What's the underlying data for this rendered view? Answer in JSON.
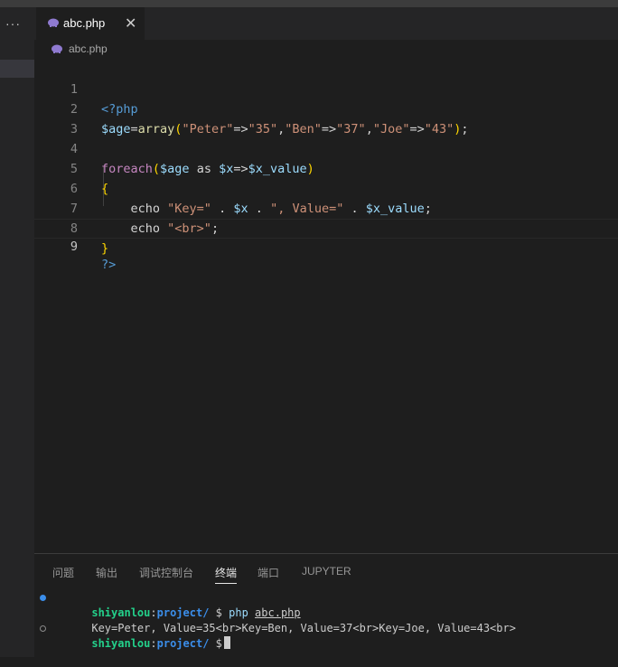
{
  "sidebar": {
    "more_label": "···"
  },
  "tab": {
    "title": "abc.php",
    "close_glyph": "✕",
    "icon": "php-elephant-icon"
  },
  "breadcrumb": {
    "file": "abc.php",
    "icon": "php-elephant-icon"
  },
  "code_lines": [
    {
      "n": "1",
      "text": "<?php"
    },
    {
      "n": "2",
      "text": "$age=array(\"Peter\"=>\"35\",\"Ben\"=>\"37\",\"Joe\"=>\"43\");"
    },
    {
      "n": "3",
      "text": ""
    },
    {
      "n": "4",
      "text": "foreach($age as $x=>$x_value)"
    },
    {
      "n": "5",
      "text": "{"
    },
    {
      "n": "6",
      "text": "    echo \"Key=\" . $x . \", Value=\" . $x_value;"
    },
    {
      "n": "7",
      "text": "    echo \"<br>\";"
    },
    {
      "n": "8",
      "text": "}"
    },
    {
      "n": "9",
      "text": "?>"
    }
  ],
  "panel": {
    "tabs": [
      "问题",
      "输出",
      "调试控制台",
      "终端",
      "端口",
      "JUPYTER"
    ],
    "active_tab": "终端"
  },
  "terminal": {
    "prompt_user": "shiyanlou",
    "prompt_path": "project/",
    "prompt_symbol": "$",
    "command": "php",
    "command_arg": "abc.php",
    "output": "Key=Peter, Value=35<br>Key=Ben, Value=37<br>Key=Joe, Value=43<br>",
    "dot_colors": [
      "#3b8eea",
      "#8a8a8a"
    ]
  },
  "colors": {
    "keyword": "#569cd6",
    "variable": "#9cdcfe",
    "string": "#ce9178",
    "function": "#dcdcaa",
    "control": "#c586c0",
    "bracket": "#ffd700",
    "bracket2": "#da70d6",
    "plain": "#d4d4d4"
  }
}
